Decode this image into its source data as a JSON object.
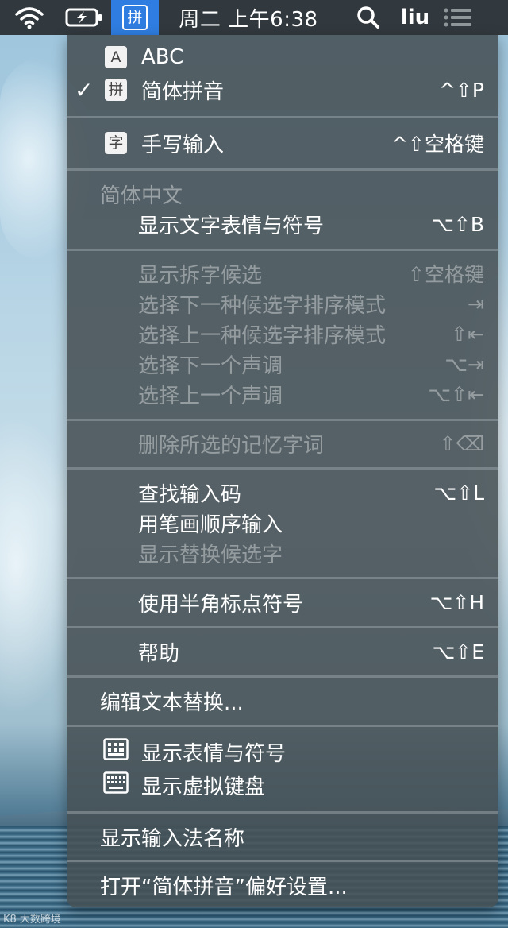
{
  "menubar": {
    "ime_glyph": "拼",
    "clock": "周二 上午6:38",
    "user": "liu"
  },
  "menu": {
    "abc_icon": "A",
    "abc_label": "ABC",
    "pinyin_check": "✓",
    "pinyin_icon": "拼",
    "pinyin_label": "简体拼音",
    "pinyin_shortcut": "^⇧P",
    "handwrite_icon": "字",
    "handwrite_label": "手写输入",
    "handwrite_shortcut": "^⇧空格键",
    "section_header": "简体中文",
    "emoji_label": "显示文字表情与符号",
    "emoji_shortcut": "⌥⇧B",
    "split_label": "显示拆字候选",
    "split_shortcut": "⇧空格键",
    "next_sort_label": "选择下一种候选字排序模式",
    "next_sort_shortcut": "⇥",
    "prev_sort_label": "选择上一种候选字排序模式",
    "prev_sort_shortcut": "⇧⇤",
    "next_tone_label": "选择下一个声调",
    "next_tone_shortcut": "⌥⇥",
    "prev_tone_label": "选择上一个声调",
    "prev_tone_shortcut": "⌥⇧⇤",
    "delete_memory_label": "删除所选的记忆字词",
    "delete_memory_shortcut": "⇧⌫",
    "lookup_label": "查找输入码",
    "lookup_shortcut": "⌥⇧L",
    "stroke_label": "用笔画顺序输入",
    "replace_label": "显示替换候选字",
    "halfwidth_label": "使用半角标点符号",
    "halfwidth_shortcut": "⌥⇧H",
    "help_label": "帮助",
    "help_shortcut": "⌥⇧E",
    "edit_replace_label": "编辑文本替换...",
    "show_emoji_label": "显示表情与符号",
    "show_keyboard_label": "显示虚拟键盘",
    "show_ime_name_label": "显示输入法名称",
    "prefs_label": "打开“简体拼音”偏好设置..."
  },
  "watermark": "K8 大数跨境"
}
